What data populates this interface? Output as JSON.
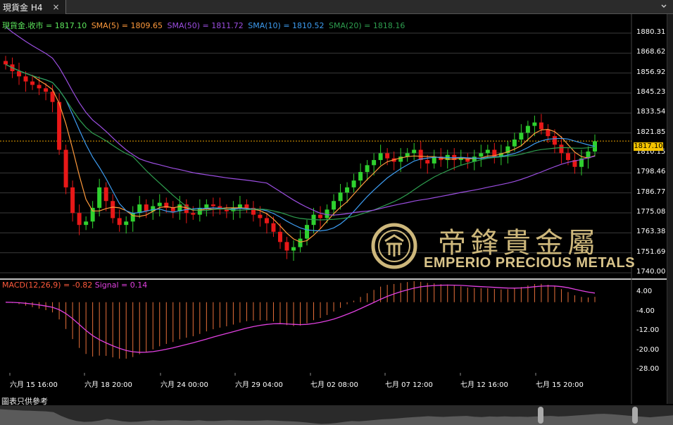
{
  "window": {
    "tab_title": "現貨金 H4",
    "close_glyph": "×"
  },
  "legend": {
    "close": {
      "text": "現貨金.收市 = 1817.10",
      "color": "#5ce65c"
    },
    "sma5": {
      "text": "SMA(5) = 1809.65",
      "color": "#ff9a3c"
    },
    "sma50": {
      "text": "SMA(50) = 1811.72",
      "color": "#9b4ee0"
    },
    "sma10": {
      "text": "SMA(10) = 1810.52",
      "color": "#3d9cf0"
    },
    "sma20": {
      "text": "SMA(20) = 1818.16",
      "color": "#2e9e4f"
    }
  },
  "macd_legend": {
    "macd": {
      "text": "MACD(12,26,9) = -0.82",
      "color": "#ff5a3c"
    },
    "signal": {
      "text": "Signal = 0.14",
      "color": "#e040e0"
    }
  },
  "price_axis": [
    "1880.31",
    "1868.62",
    "1856.92",
    "1845.23",
    "1833.54",
    "1821.85",
    "1810.15",
    "1798.46",
    "1786.77",
    "1775.08",
    "1763.38",
    "1751.69",
    "1740.00"
  ],
  "current_price": "1817.10",
  "macd_axis": [
    "4.00",
    "-4.00",
    "-12.00",
    "-20.00",
    "-28.00"
  ],
  "time_axis": [
    "六月 15 16:00",
    "六月 18 20:00",
    "六月 24 00:00",
    "六月 29 04:00",
    "七月 02 08:00",
    "七月 07 12:00",
    "七月 12 16:00",
    "七月 15 20:00"
  ],
  "logo": {
    "chinese": "帝鋒貴金屬",
    "english": "EMPERIO PRECIOUS METALS"
  },
  "footer_note": "圖表只供參考",
  "colors": {
    "up": "#2fd12f",
    "down": "#e81818",
    "grid": "#3a3a3a",
    "dotted_price": "#e8a000"
  },
  "chart_data": {
    "type": "candlestick",
    "ylim": [
      1740.0,
      1880.31
    ],
    "closes": [
      1862,
      1858,
      1855,
      1852,
      1850,
      1848,
      1846,
      1840,
      1812,
      1790,
      1775,
      1768,
      1770,
      1778,
      1790,
      1782,
      1772,
      1768,
      1770,
      1775,
      1780,
      1776,
      1779,
      1781,
      1778,
      1776,
      1780,
      1775,
      1774,
      1778,
      1780,
      1779,
      1777,
      1776,
      1778,
      1780,
      1778,
      1774,
      1772,
      1769,
      1764,
      1758,
      1753,
      1755,
      1760,
      1768,
      1774,
      1772,
      1777,
      1782,
      1787,
      1790,
      1794,
      1799,
      1803,
      1806,
      1810,
      1807,
      1805,
      1808,
      1810,
      1812,
      1806,
      1804,
      1808,
      1806,
      1809,
      1806,
      1807,
      1805,
      1808,
      1810,
      1812,
      1808,
      1810,
      1814,
      1818,
      1822,
      1826,
      1828,
      1824,
      1820,
      1815,
      1810,
      1806,
      1802,
      1807,
      1811,
      1817
    ]
  }
}
